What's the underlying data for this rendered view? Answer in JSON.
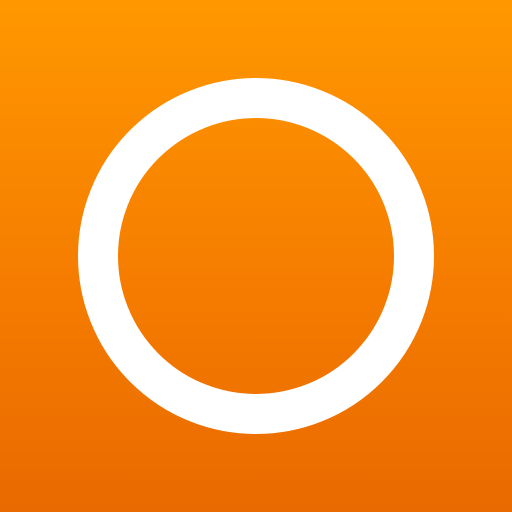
{
  "app_icon": {
    "icon_name": "ring-icon",
    "colors": {
      "background_top": "#FF9800",
      "background_bottom": "#E96A00",
      "ring": "#FFFFFF"
    }
  }
}
